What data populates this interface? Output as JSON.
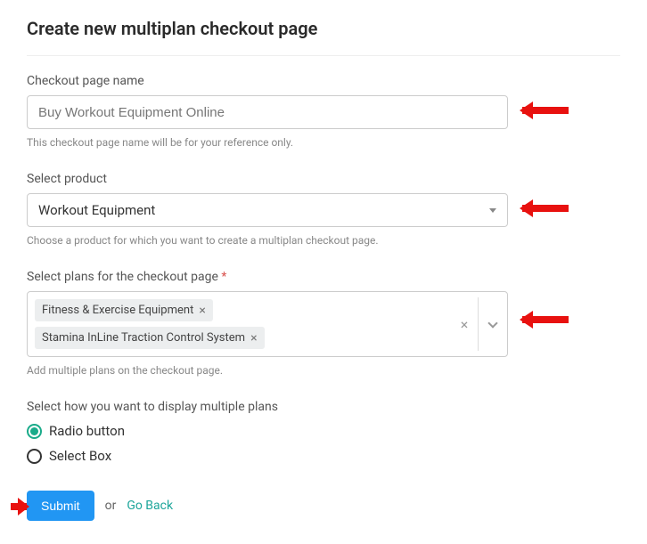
{
  "title": "Create new multiplan checkout page",
  "checkout_name": {
    "label": "Checkout page name",
    "value": "Buy Workout Equipment Online",
    "helper": "This checkout page name will be for your reference only."
  },
  "product": {
    "label": "Select product",
    "value": "Workout Equipment",
    "helper": "Choose a product for which you want to create a multiplan checkout page."
  },
  "plans": {
    "label_text": "Select plans for the checkout page",
    "required_mark": "*",
    "tags": [
      "Fitness & Exercise Equipment",
      "Stamina InLine Traction Control System"
    ],
    "helper": "Add multiple plans on the checkout page."
  },
  "display": {
    "label": "Select how you want to display multiple plans",
    "options": [
      {
        "label": "Radio button",
        "checked": true
      },
      {
        "label": "Select Box",
        "checked": false
      }
    ]
  },
  "actions": {
    "submit": "Submit",
    "or": "or",
    "go_back": "Go Back"
  }
}
